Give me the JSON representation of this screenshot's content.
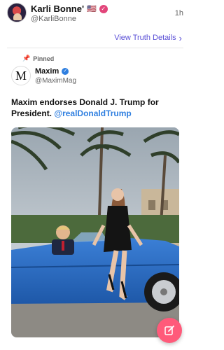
{
  "author": {
    "display_name": "Karli Bonne'",
    "flag": "🇺🇸",
    "handle": "@KarliBonne",
    "timestamp": "1h",
    "avatar_icon": "avatar-icon",
    "verified_icon": "verified-badge-icon"
  },
  "view_details": {
    "label": "View Truth Details"
  },
  "quoted": {
    "pinned_label": "Pinned",
    "name": "Maxim",
    "handle": "@MaximMag",
    "logo_letter": "M",
    "text_main": "Maxim endorses Donald J. Trump for President.",
    "mention": "@realDonaldTrump"
  },
  "colors": {
    "accent": "#5a4fd6",
    "verified_pink": "#e2457a",
    "mention_blue": "#2f7fe0",
    "fab": "#ff5a7a"
  },
  "icons": {
    "compose": "compose-icon",
    "chevron": "chevron-right-icon",
    "pin": "pin-icon"
  }
}
